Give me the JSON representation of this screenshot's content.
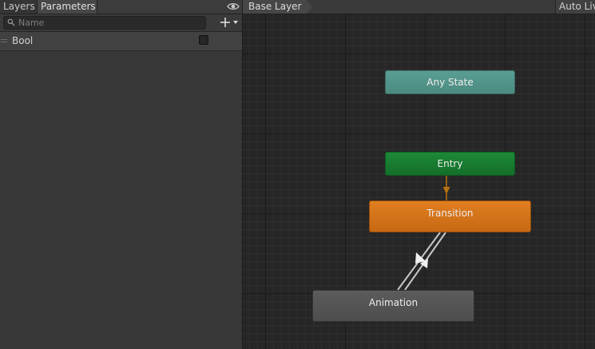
{
  "tabs": {
    "layers": "Layers",
    "parameters": "Parameters"
  },
  "search": {
    "placeholder": "Name",
    "value": ""
  },
  "parameters": [
    {
      "name": "Bool",
      "type": "bool",
      "value": false
    }
  ],
  "graph": {
    "breadcrumb": "Base Layer",
    "auto_live_link": "Auto Live Link"
  },
  "states": {
    "any_state": "Any State",
    "entry": "Entry",
    "transition": "Transition",
    "animation": "Animation"
  },
  "colors": {
    "any_state": "#53958a",
    "entry": "#187c30",
    "transition_state": "#d5741a",
    "animation_state": "#555555",
    "entry_arrow": "#b8730e",
    "transition_line": "#c8c8c8",
    "panel_bg": "#383838",
    "graph_bg": "#262626"
  },
  "icons": {
    "eye": "eye-icon",
    "search": "search-icon",
    "add": "plus-dropdown-icon",
    "drag": "drag-handle-icon"
  }
}
